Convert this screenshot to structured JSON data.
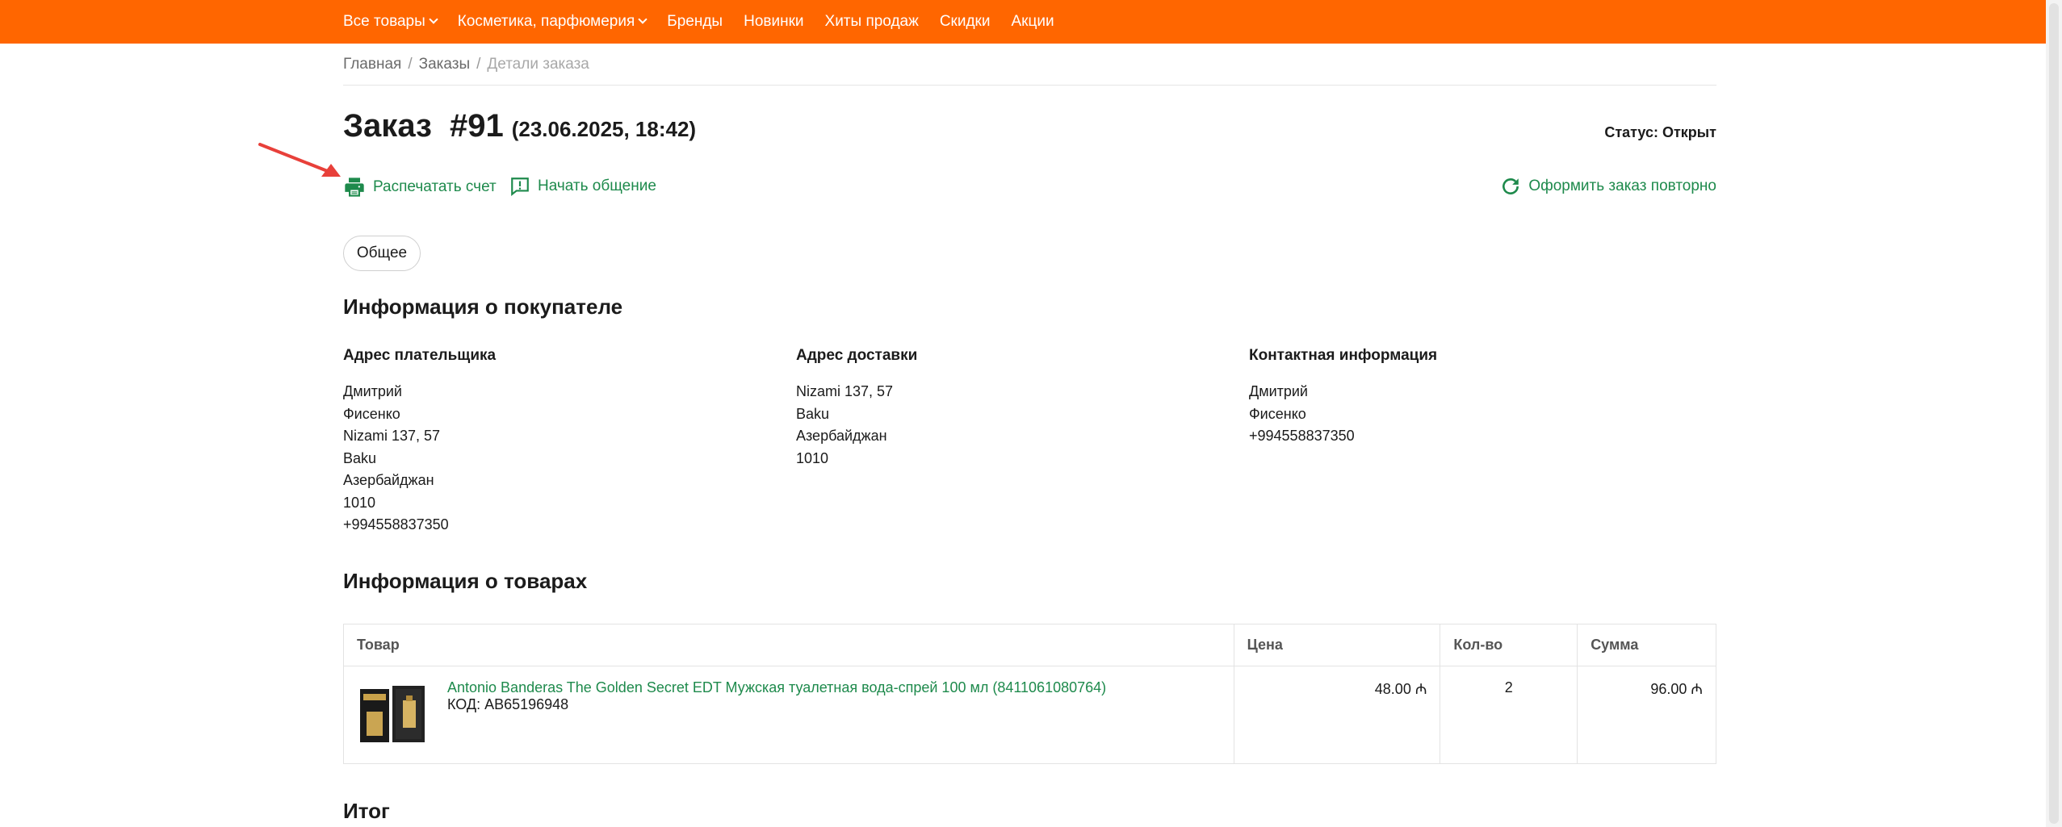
{
  "nav": {
    "items": [
      {
        "label": "Все товары",
        "dropdown": true
      },
      {
        "label": "Косметика, парфюмерия",
        "dropdown": true
      },
      {
        "label": "Бренды",
        "dropdown": false
      },
      {
        "label": "Новинки",
        "dropdown": false
      },
      {
        "label": "Хиты продаж",
        "dropdown": false
      },
      {
        "label": "Скидки",
        "dropdown": false
      },
      {
        "label": "Акции",
        "dropdown": false
      }
    ]
  },
  "breadcrumb": {
    "home": "Главная",
    "sep": "/",
    "orders": "Заказы",
    "current": "Детали заказа"
  },
  "order": {
    "title": "Заказ",
    "number": "#91",
    "date": "(23.06.2025, 18:42)",
    "status": "Статус: Открыт"
  },
  "actions": {
    "print": "Распечатать счет",
    "chat": "Начать общение",
    "reorder": "Оформить заказ повторно"
  },
  "tabs": {
    "general": "Общее"
  },
  "customer": {
    "title": "Информация о покупателе",
    "billing": {
      "title": "Адрес плательщика",
      "lines": [
        "Дмитрий",
        "Фисенко",
        "Nizami 137, 57",
        "Baku",
        "Азербайджан",
        "1010",
        "+994558837350"
      ]
    },
    "shipping": {
      "title": "Адрес доставки",
      "lines": [
        "Nizami 137, 57",
        "Baku",
        "Азербайджан",
        "1010"
      ]
    },
    "contact": {
      "title": "Контактная информация",
      "lines": [
        "Дмитрий",
        "Фисенко",
        "+994558837350"
      ]
    }
  },
  "products": {
    "title": "Информация о товарах",
    "columns": {
      "product": "Товар",
      "price": "Цена",
      "qty": "Кол-во",
      "sum": "Сумма"
    },
    "rows": [
      {
        "name": "Antonio Banderas The Golden Secret EDT Мужская туалетная вода-спрей 100 мл (8411061080764)",
        "code": "КОД: AB65196948",
        "price": "48.00 ₼",
        "qty": "2",
        "sum": "96.00 ₼"
      }
    ]
  },
  "total": {
    "title": "Итог"
  },
  "colors": {
    "brand": "#ff6600",
    "link": "#1e8a4c",
    "arrow": "#e8403a"
  }
}
